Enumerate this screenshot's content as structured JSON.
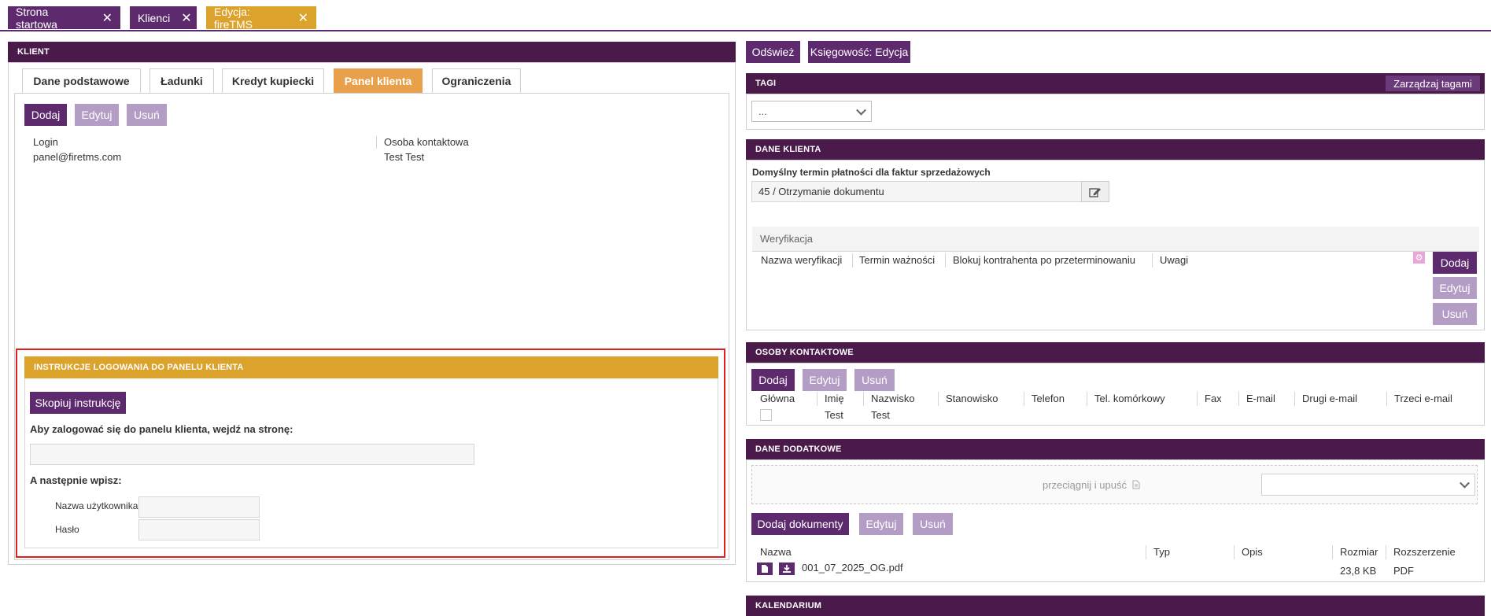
{
  "top_tabs": [
    {
      "label": "Strona startowa"
    },
    {
      "label": "Klienci"
    },
    {
      "label": "Edycja: fireTMS"
    }
  ],
  "close_glyph": "✕",
  "left": {
    "header": "KLIENT",
    "tabs": [
      "Dane podstawowe",
      "Ładunki",
      "Kredyt kupiecki",
      "Panel klienta",
      "Ograniczenia"
    ],
    "active_tab": "Panel klienta",
    "buttons": {
      "add": "Dodaj",
      "edit": "Edytuj",
      "delete": "Usuń"
    },
    "login_label": "Login",
    "login_value": "panel@firetms.com",
    "contact_label": "Osoba kontaktowa",
    "contact_value": "Test Test",
    "instructions": {
      "header": "INSTRUKCJE LOGOWANIA DO PANELU KLIENTA",
      "copy_button": "Skopiuj instrukcję",
      "go_to_text": "Aby zalogować się do panelu klienta, wejdź na stronę:",
      "then_text": "A następnie wpisz:",
      "username_label": "Nazwa użytkownika",
      "password_label": "Hasło"
    }
  },
  "right": {
    "top_buttons": {
      "refresh": "Odśwież",
      "accounting": "Księgowość: Edycja"
    },
    "tags": {
      "header": "TAGI",
      "manage_button": "Zarządzaj tagami",
      "select_value": "..."
    },
    "client_data": {
      "header": "DANE KLIENTA",
      "payment_label": "Domyślny termin płatności dla faktur sprzedażowych",
      "payment_value": "45 / Otrzymanie dokumentu",
      "verification_title": "Weryfikacja",
      "columns": [
        "Nazwa weryfikacji",
        "Termin ważności",
        "Blokuj kontrahenta po przeterminowaniu",
        "Uwagi"
      ],
      "buttons": {
        "add": "Dodaj",
        "edit": "Edytuj",
        "delete": "Usuń"
      }
    },
    "contacts": {
      "header": "OSOBY KONTAKTOWE",
      "buttons": {
        "add": "Dodaj",
        "edit": "Edytuj",
        "delete": "Usuń"
      },
      "columns": [
        "Główna",
        "Imię",
        "Nazwisko",
        "Stanowisko",
        "Telefon",
        "Tel. komórkowy",
        "Fax",
        "E-mail",
        "Drugi e-mail",
        "Trzeci e-mail"
      ],
      "row": {
        "first_name": "Test",
        "last_name": "Test"
      }
    },
    "extra_data": {
      "header": "DANE DODATKOWE",
      "dropzone_text": "przeciągnij i upuść",
      "buttons": {
        "add": "Dodaj dokumenty",
        "edit": "Edytuj",
        "delete": "Usuń"
      },
      "columns": [
        "Nazwa",
        "Typ",
        "Opis",
        "Rozmiar",
        "Rozszerzenie"
      ],
      "file": {
        "name": "001_07_2025_OG.pdf",
        "size": "23,8 KB",
        "ext": "PDF"
      }
    },
    "calendar": {
      "header": "KALENDARIUM"
    }
  },
  "colors": {
    "purple": "#5e2a6e",
    "dark_header": "#4a1a4a",
    "light_purple": "#b39dc4",
    "orange_tab": "#dca32c",
    "highlight_red": "#e0201f"
  }
}
